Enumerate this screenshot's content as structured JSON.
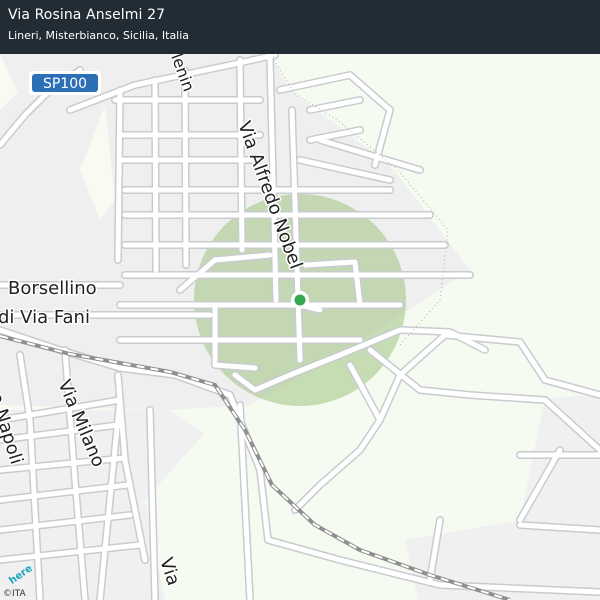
{
  "header": {
    "title": "Via Rosina Anselmi 27",
    "subtitle": "Lineri, Misterbianco, Sicilia, Italia"
  },
  "map": {
    "shield": "SP100",
    "streets": {
      "via_alfredo_nobel": "Via Alfredo Nobel",
      "borsellino": "Borsellino",
      "via_fani": "di Via Fani",
      "via_milano": "Via Milano",
      "napoli": "o Napoli",
      "via_bottom": "Via",
      "lenin": "lenin"
    },
    "attribution": "©ITA",
    "logo": "here",
    "colors": {
      "header_bg": "#222c35",
      "accuracy_circle": "#9fc57f",
      "location_dot": "#35a852",
      "shield": "#2d6fb6",
      "urban_area": "#f1f1f1",
      "open_land": "#f6fbf1"
    },
    "icons": [
      "location-dot-icon",
      "road-shield-icon",
      "here-logo-icon"
    ]
  }
}
